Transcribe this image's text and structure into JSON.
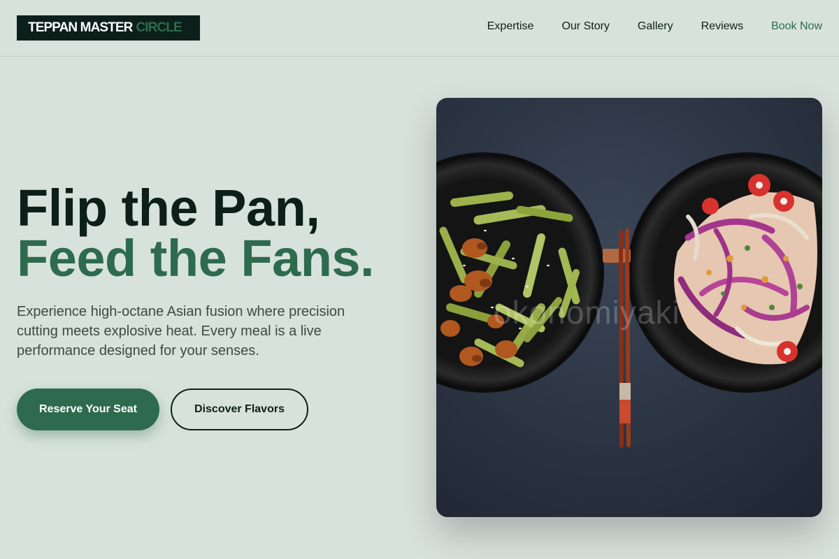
{
  "brand": {
    "name_part1": "TEPPAN MASTER",
    "name_part2": "CIRCLE"
  },
  "nav": {
    "items": [
      {
        "label": "Expertise"
      },
      {
        "label": "Our Story"
      },
      {
        "label": "Gallery"
      },
      {
        "label": "Reviews"
      },
      {
        "label": "Book Now"
      }
    ]
  },
  "hero": {
    "title_line1": "Flip the Pan,",
    "title_line2": "Feed the Fans.",
    "description": "Experience high-octane Asian fusion where precision cutting meets explosive heat. Every meal is a live performance designed for your senses.",
    "primary_button": "Reserve Your Seat",
    "secondary_button": "Discover Flavors"
  },
  "image": {
    "watermark": "okonomiyaki"
  },
  "colors": {
    "background": "#d8e2dc",
    "dark": "#0d1f1a",
    "accent": "#2e6b4e",
    "body_text": "#3b4a45"
  }
}
